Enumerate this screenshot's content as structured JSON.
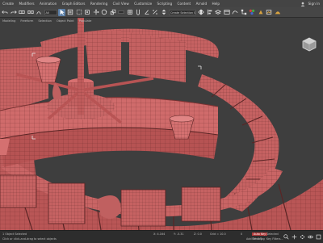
{
  "menu": {
    "items": [
      "Create",
      "Modifiers",
      "Animation",
      "Graph Editors",
      "Rendering",
      "Civil View",
      "Customize",
      "Scripting",
      "Content",
      "Arnold",
      "Help"
    ],
    "sign_in": "Sign In"
  },
  "toolbar": {
    "select_filter": "All",
    "named_set": "Create Selection Set",
    "icons": [
      "undo-icon",
      "redo-icon",
      "link-icon",
      "unlink-icon",
      "bind-icon",
      "select-icon",
      "select-by-name-icon",
      "rect-select-icon",
      "window-crossing-icon",
      "move-icon",
      "rotate-icon",
      "scale-icon",
      "reference-coord-icon",
      "pivot-icon",
      "snap-icon",
      "angle-snap-icon",
      "percent-snap-icon",
      "spinner-snap-icon",
      "edit-named-icon",
      "mirror-icon",
      "align-icon",
      "layer-icon",
      "ribbon-icon",
      "curve-editor-icon",
      "schematic-icon",
      "material-editor-icon",
      "render-setup-icon",
      "rendered-frame-icon",
      "render-icon"
    ]
  },
  "ribbon_tabs": [
    "Modeling",
    "Freeform",
    "Selection",
    "Object Paint",
    "Populate"
  ],
  "viewport": {
    "label": "[+] [Perspective] [Standard] [Edged Faces]",
    "viewcube": "viewcube-icon"
  },
  "status": {
    "selection": "1 Object Selected",
    "prompt": "Click or click-and-drag to select objects",
    "coords_x": "X: 4.164",
    "coords_y": "Y: -5.31",
    "coords_z": "Z: 0.0",
    "grid": "Grid = 10.0",
    "add_time_tag": "Add Time Tag",
    "frame": "0",
    "autokey": "Auto Key",
    "selected": "Selected",
    "set_key": "Set Key",
    "key_filters": "Key Filters..."
  },
  "colors": {
    "model": "#c66262",
    "model_dark": "#8a3f3f",
    "wire": "#5a2525",
    "background": "#3e3e3e"
  }
}
